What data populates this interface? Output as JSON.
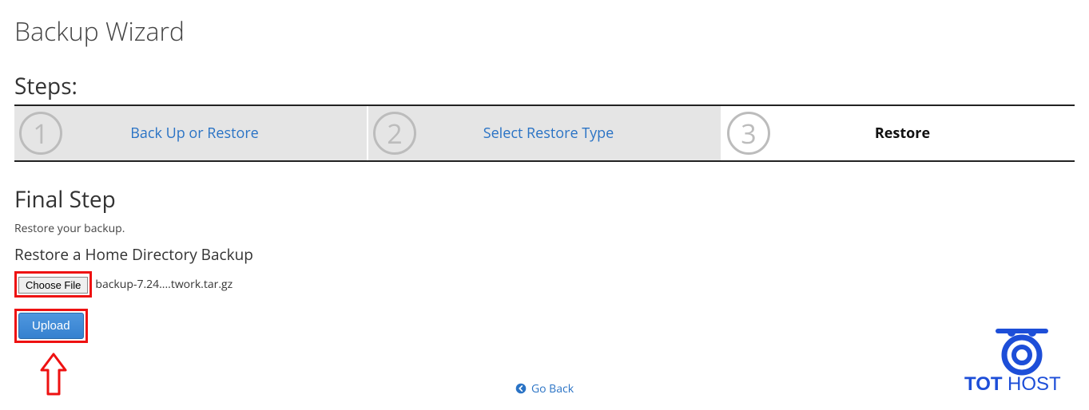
{
  "page": {
    "title": "Backup Wizard"
  },
  "steps": {
    "label": "Steps:",
    "items": [
      {
        "number": "1",
        "label": "Back Up or Restore"
      },
      {
        "number": "2",
        "label": "Select Restore Type"
      },
      {
        "number": "3",
        "label": "Restore"
      }
    ]
  },
  "section": {
    "title": "Final Step",
    "description": "Restore your backup.",
    "restore_heading": "Restore a Home Directory Backup"
  },
  "file": {
    "choose_label": "Choose File",
    "filename": "backup-7.24....twork.tar.gz"
  },
  "actions": {
    "upload_label": "Upload",
    "goback_label": "Go Back"
  },
  "branding": {
    "logo_text_left": "TOT",
    "logo_text_right": "HOST"
  },
  "colors": {
    "link": "#2a73c5",
    "highlight": "#e11",
    "primary_btn": "#3b8ad9",
    "brand": "#1d4ed8"
  }
}
